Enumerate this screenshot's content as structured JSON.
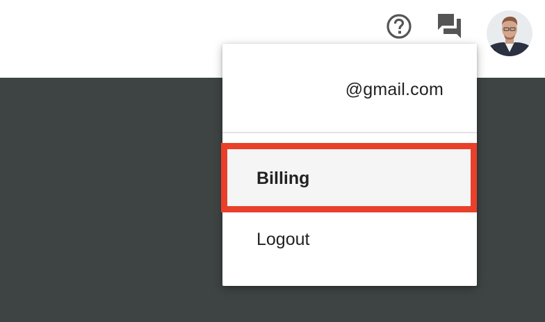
{
  "colors": {
    "background_dark": "#3e4443",
    "topbar": "#ffffff",
    "icon": "#555555",
    "highlight": "#e8402a",
    "text": "#222222"
  },
  "header": {
    "help_icon": "help-circle-icon",
    "chat_icon": "forum-icon",
    "avatar": "user-avatar"
  },
  "account_menu": {
    "email": "@gmail.com",
    "items": [
      {
        "label": "Billing",
        "highlighted": true
      },
      {
        "label": "Logout",
        "highlighted": false
      }
    ]
  }
}
